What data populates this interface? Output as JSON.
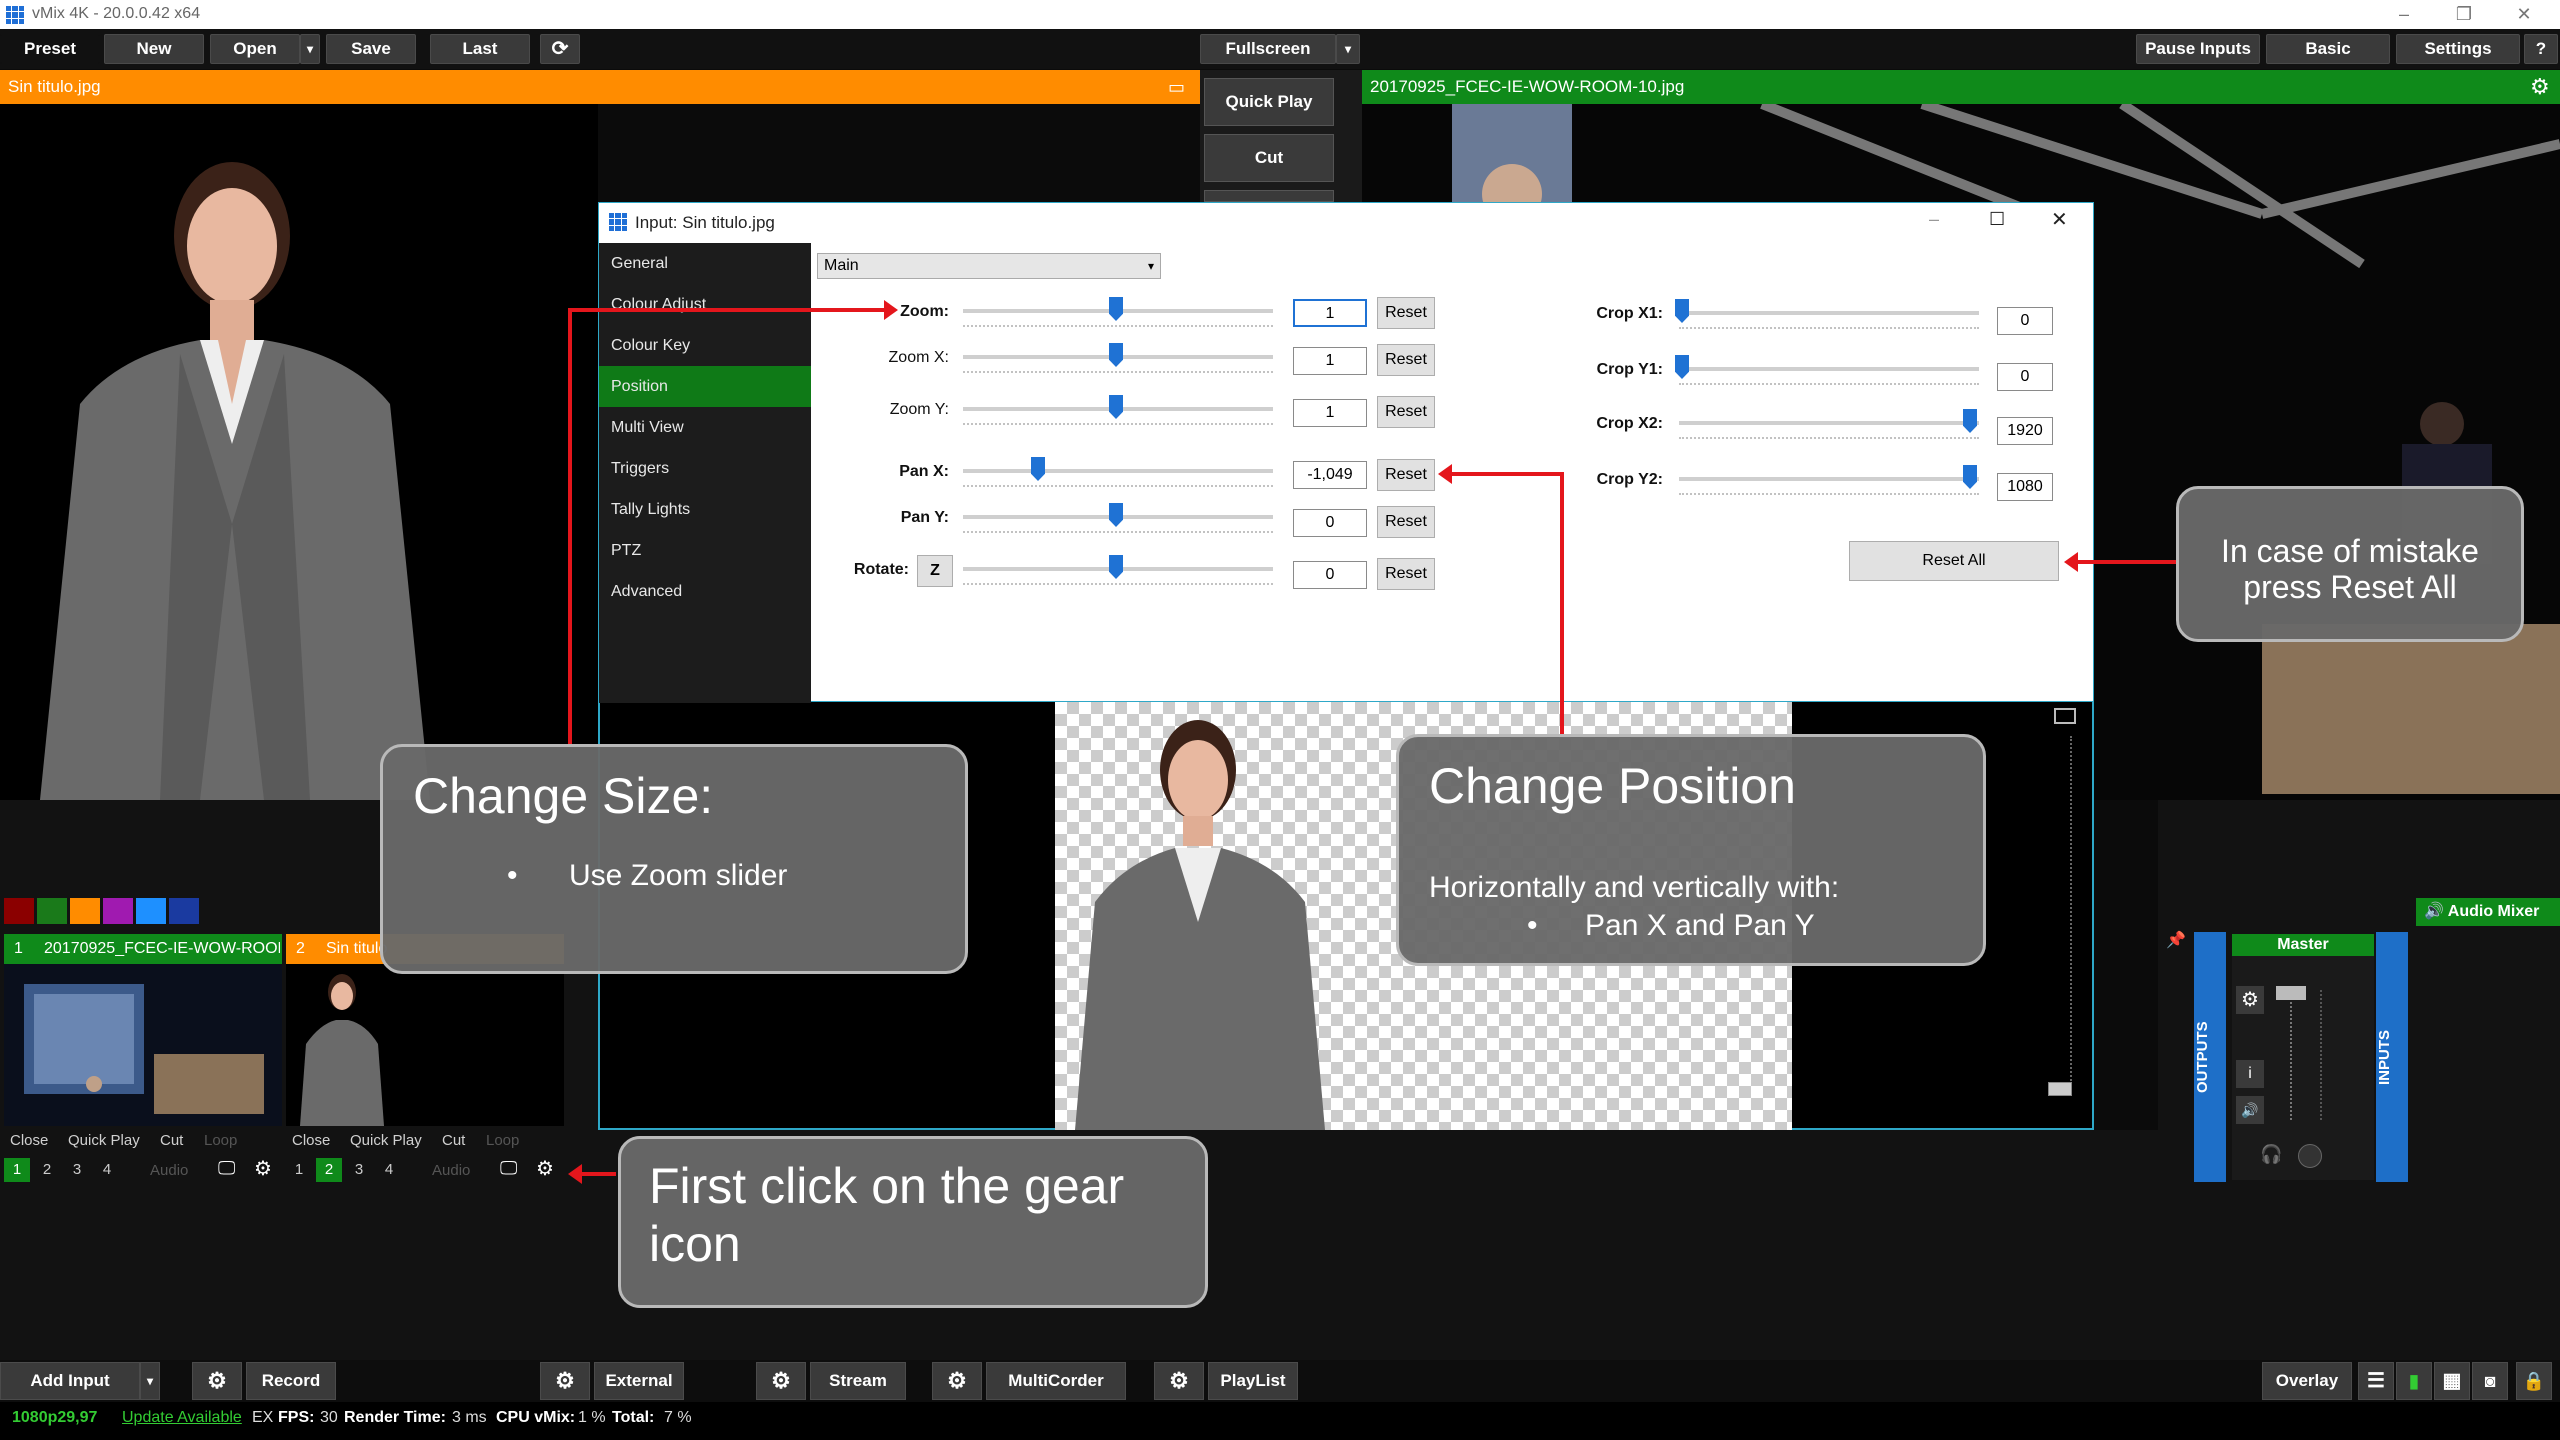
{
  "app": {
    "title": "vMix 4K - 20.0.0.42 x64",
    "window_controls": [
      "–",
      "❐",
      "✕"
    ]
  },
  "toolbar": {
    "preset": "Preset",
    "new": "New",
    "open": "Open",
    "save": "Save",
    "last": "Last",
    "fullscreen": "Fullscreen",
    "pause_inputs": "Pause Inputs",
    "basic": "Basic",
    "settings": "Settings",
    "help": "?"
  },
  "preview": {
    "title": "Sin titulo.jpg",
    "color": "#ff8c00"
  },
  "program": {
    "title": "20170925_FCEC-IE-WOW-ROOM-10.jpg",
    "color": "#0f8a1a"
  },
  "transitions": {
    "quick_play": "Quick Play",
    "cut": "Cut"
  },
  "dialog": {
    "title": "Input: Sin titulo.jpg",
    "nav": [
      "General",
      "Colour Adjust",
      "Colour Key",
      "Position",
      "Multi View",
      "Triggers",
      "Tally Lights",
      "PTZ",
      "Advanced"
    ],
    "active_nav": "Position",
    "layer_select": "Main",
    "zoom_label": "Zoom:",
    "zoom_x_label": "Zoom X:",
    "zoom_y_label": "Zoom Y:",
    "pan_x_label": "Pan X:",
    "pan_y_label": "Pan Y:",
    "rotate_label": "Rotate:",
    "rotate_btn": "Z",
    "zoom": "1",
    "zoom_x": "1",
    "zoom_y": "1",
    "pan_x": "-1,049",
    "pan_y": "0",
    "rotate": "0",
    "reset": "Reset",
    "crop_x1_label": "Crop X1:",
    "crop_y1_label": "Crop Y1:",
    "crop_x2_label": "Crop X2:",
    "crop_y2_label": "Crop Y2:",
    "crop_x1": "0",
    "crop_y1": "0",
    "crop_x2": "1920",
    "crop_y2": "1080",
    "reset_all": "Reset All"
  },
  "callouts": {
    "change_size_title": "Change Size:",
    "change_size_bullet": "Use Zoom slider",
    "change_position_title": "Change Position",
    "change_position_line": "Horizontally and vertically with:",
    "change_position_bullet": "Pan X and Pan Y",
    "gear_line1": "First click on the gear",
    "gear_line2": "icon",
    "reset_line1": "In case of mistake",
    "reset_line2": "press Reset All",
    "bullet": "•"
  },
  "color_swatches": [
    "#8b0000",
    "#1a7a1a",
    "#ff8c00",
    "#a01ab0",
    "#1e90ff",
    "#1a3aa0"
  ],
  "inputs": [
    {
      "number": "1",
      "name": "20170925_FCEC-IE-WOW-ROOM-10",
      "color": "#0f8a1a",
      "active_num": "1"
    },
    {
      "number": "2",
      "name": "Sin titulo",
      "color": "#ff8c00",
      "active_num": "2"
    }
  ],
  "input_controls": {
    "close": "Close",
    "quick_play": "Quick Play",
    "cut": "Cut",
    "loop": "Loop",
    "audio": "Audio",
    "nums": [
      "1",
      "2",
      "3",
      "4"
    ]
  },
  "audio": {
    "mixer": "Audio Mixer",
    "master": "Master",
    "outputs": "OUTPUTS",
    "inputs": "INPUTS",
    "info": "i"
  },
  "bottombar": {
    "add_input": "Add Input",
    "record": "Record",
    "external": "External",
    "stream": "Stream",
    "multicorder": "MultiCorder",
    "playlist": "PlayList",
    "overlay": "Overlay"
  },
  "status": {
    "format": "1080p29,97",
    "update": "Update Available",
    "ex": "EX",
    "fps_label": "FPS:",
    "fps": "30",
    "render_label": "Render Time:",
    "render": "3 ms",
    "cpu_label": "CPU vMix:",
    "cpu": "1 %",
    "total_label": "Total:",
    "total": "7 %"
  }
}
